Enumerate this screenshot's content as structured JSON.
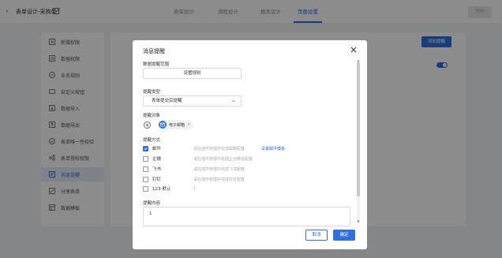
{
  "header": {
    "title": "表单设计-采购单",
    "tabs": [
      {
        "label": "表单设计"
      },
      {
        "label": "流程设计"
      },
      {
        "label": "报表设计"
      },
      {
        "label": "页面设置"
      }
    ],
    "active_tab": "页面设置",
    "publish_label": "发布"
  },
  "sidebar": {
    "items": [
      {
        "label": "新增权限",
        "icon": "plus-square-icon"
      },
      {
        "label": "数据权限",
        "icon": "database-icon"
      },
      {
        "label": "业务规则",
        "icon": "rule-icon"
      },
      {
        "label": "自定义按钮",
        "icon": "button-icon"
      },
      {
        "label": "数据导入",
        "icon": "import-icon"
      },
      {
        "label": "数据导出",
        "icon": "export-icon"
      },
      {
        "label": "表单唯一性校验",
        "icon": "check-icon"
      },
      {
        "label": "表单授权权限",
        "icon": "share-icon"
      },
      {
        "label": "消息提醒",
        "icon": "bell-icon",
        "active": true
      },
      {
        "label": "分享表单",
        "icon": "share-form-icon"
      },
      {
        "label": "数据模板",
        "icon": "template-icon"
      }
    ]
  },
  "right_panel": {
    "add_reminder_label": "添加提醒"
  },
  "modal": {
    "title": "消息提醒",
    "range_label": "数据提醒范围",
    "range_button": "设置规则",
    "type_label": "提醒类型",
    "type_value": "表单提交后提醒",
    "target_label": "提醒对象",
    "target_chip": "电子邮箱",
    "method_label": "提醒方式",
    "methods": [
      {
        "name": "邮件",
        "checked": true,
        "desc": "请在插件管理中完成邮箱配置",
        "link": "设置邮件模板"
      },
      {
        "name": "企微",
        "checked": false,
        "desc": "请在插件管理中完成企业微信配置",
        "link": ""
      },
      {
        "name": "飞书",
        "checked": false,
        "desc": "请在插件管理中完成飞书配置",
        "link": ""
      },
      {
        "name": "钉钉",
        "checked": false,
        "desc": "请在插件管理中完成钉钉配置",
        "link": ""
      },
      {
        "name": "123-默认",
        "checked": false,
        "desc": "1",
        "link": ""
      }
    ],
    "content_label": "提醒内容",
    "content_value": "1",
    "cancel_label": "取消",
    "ok_label": "确定"
  },
  "colors": {
    "accent": "#2f6fe0",
    "overlay": "rgba(0,0,0,0.45)"
  }
}
